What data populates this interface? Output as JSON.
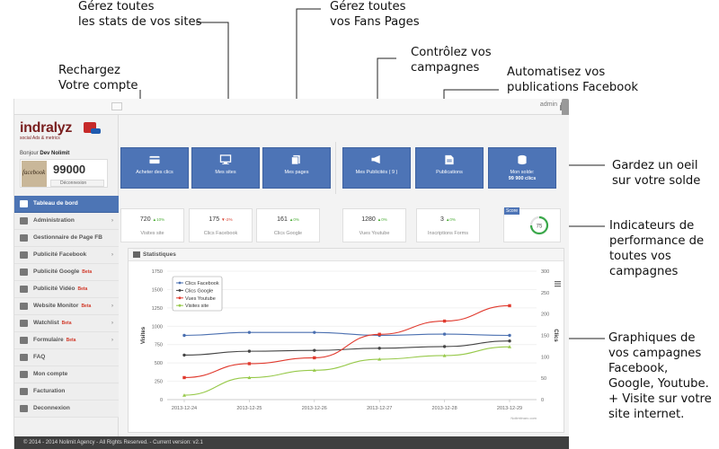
{
  "annotations": {
    "stats_sites": [
      "Gérez toutes",
      "les stats de vos sites"
    ],
    "fans_pages": [
      "Gérez toutes",
      "vos Fans Pages"
    ],
    "campaigns": [
      "Contrôlez vos",
      "campagnes"
    ],
    "recharge": [
      "Rechargez",
      "Votre compte"
    ],
    "automate": [
      "Automatisez vos",
      "publications Facebook"
    ],
    "balance": [
      "Gardez un oeil",
      "sur votre solde"
    ],
    "kpis": [
      "Indicateurs de",
      "performance de",
      "toutes vos",
      "campagnes"
    ],
    "graphs": [
      "Graphiques de",
      "vos campagnes",
      "Facebook,",
      "Google, Youtube.",
      "+ Visite sur votre",
      "site internet."
    ]
  },
  "topbar": {
    "user": "admin"
  },
  "brand": {
    "name": "indralyz",
    "tagline": "social Ads & metrics"
  },
  "account": {
    "greeting": "Bonjour",
    "username": "Dev Nolimit",
    "balance": "99000",
    "logout_label": "Déconnexion",
    "avatar_text": "facebook"
  },
  "sidebar": {
    "items": [
      {
        "label": "Tableau de bord",
        "icon": "monitor-icon",
        "active": true,
        "beta": "",
        "arrow": ""
      },
      {
        "label": "Administration",
        "icon": "gears-icon",
        "active": false,
        "beta": "",
        "arrow": "›"
      },
      {
        "label": "Gestionnaire de Page FB",
        "icon": "pages-icon",
        "active": false,
        "beta": "",
        "arrow": ""
      },
      {
        "label": "Publicité Facebook",
        "icon": "facebook-icon",
        "active": false,
        "beta": "",
        "arrow": "›"
      },
      {
        "label": "Publicité Google",
        "icon": "google-icon",
        "active": false,
        "beta": "Beta",
        "arrow": ""
      },
      {
        "label": "Publicité Vidéo",
        "icon": "video-icon",
        "active": false,
        "beta": "Beta",
        "arrow": ""
      },
      {
        "label": "Website Monitor",
        "icon": "monitor-web-icon",
        "active": false,
        "beta": "Beta",
        "arrow": "›"
      },
      {
        "label": "Watchlist",
        "icon": "eye-icon",
        "active": false,
        "beta": "Beta",
        "arrow": "›"
      },
      {
        "label": "Formulaire",
        "icon": "form-icon",
        "active": false,
        "beta": "Beta",
        "arrow": "›"
      },
      {
        "label": "FAQ",
        "icon": "question-icon",
        "active": false,
        "beta": "",
        "arrow": ""
      },
      {
        "label": "Mon compte",
        "icon": "user-icon",
        "active": false,
        "beta": "",
        "arrow": ""
      },
      {
        "label": "Facturation",
        "icon": "invoice-icon",
        "active": false,
        "beta": "",
        "arrow": ""
      },
      {
        "label": "Deconnexion",
        "icon": "close-icon",
        "active": false,
        "beta": "",
        "arrow": ""
      }
    ]
  },
  "tiles": [
    {
      "label": "Acheter des clics",
      "value": "",
      "icon": "card-icon"
    },
    {
      "label": "Mes sites",
      "value": "",
      "icon": "monitor-icon"
    },
    {
      "label": "Mes pages",
      "value": "",
      "icon": "pages-icon"
    },
    {
      "label": "Mes Publicités ( 9 )",
      "value": "",
      "icon": "megaphone-icon"
    },
    {
      "label": "Publications",
      "value": "",
      "icon": "document-icon"
    },
    {
      "label": "Mon solde:",
      "value": "99 900 clics",
      "icon": "coins-icon"
    }
  ],
  "stats": [
    {
      "value": "720",
      "pct": "10%",
      "dir": "up",
      "label": "Visites site"
    },
    {
      "value": "175",
      "pct": "-2%",
      "dir": "down",
      "label": "Clics Facebook"
    },
    {
      "value": "161",
      "pct": "0%",
      "dir": "up",
      "label": "Clics Google"
    },
    {
      "value": "1280",
      "pct": "0%",
      "dir": "up",
      "label": "Vues Youtube"
    },
    {
      "value": "3",
      "pct": "0%",
      "dir": "up",
      "label": "Inscriptions Forms"
    }
  ],
  "score": {
    "label": "Score",
    "value": "75",
    "gauge_fraction": 0.75
  },
  "panel": {
    "title": "Statistiques"
  },
  "chart_data": {
    "type": "line",
    "title": "",
    "xlabel": "",
    "ylabel": "Visites",
    "y2label": "Clics",
    "categories": [
      "2013-12-24",
      "2013-12-25",
      "2013-12-26",
      "2013-12-27",
      "2013-12-28",
      "2013-12-29"
    ],
    "ylim": [
      0,
      1750
    ],
    "y2lim": [
      0,
      300
    ],
    "yticks": [
      0,
      250,
      500,
      750,
      1000,
      1250,
      1500,
      1750
    ],
    "y2ticks": [
      0,
      50,
      100,
      150,
      200,
      250,
      300
    ],
    "grid": true,
    "legend_position": "top-left",
    "credit": "Nolimitnarc.com",
    "menu_icon": "hamburger-icon",
    "series": [
      {
        "name": "Clics Facebook",
        "axis": "right",
        "color": "#4a6fb0",
        "values": [
          150,
          157,
          157,
          150,
          153,
          150
        ]
      },
      {
        "name": "Clics Google",
        "axis": "right",
        "color": "#444444",
        "values": [
          104,
          113,
          115,
          120,
          124,
          137
        ]
      },
      {
        "name": "Vues Youtube",
        "axis": "left",
        "color": "#e03a2e",
        "values": [
          300,
          490,
          570,
          890,
          1070,
          1280
        ]
      },
      {
        "name": "Visites site",
        "axis": "left",
        "color": "#97c94a",
        "values": [
          60,
          300,
          400,
          550,
          600,
          720
        ]
      }
    ]
  },
  "footer": {
    "text": "© 2014 - 2014 Nolimit Agency - All Rights Reserved. - Current version: v2.1"
  }
}
